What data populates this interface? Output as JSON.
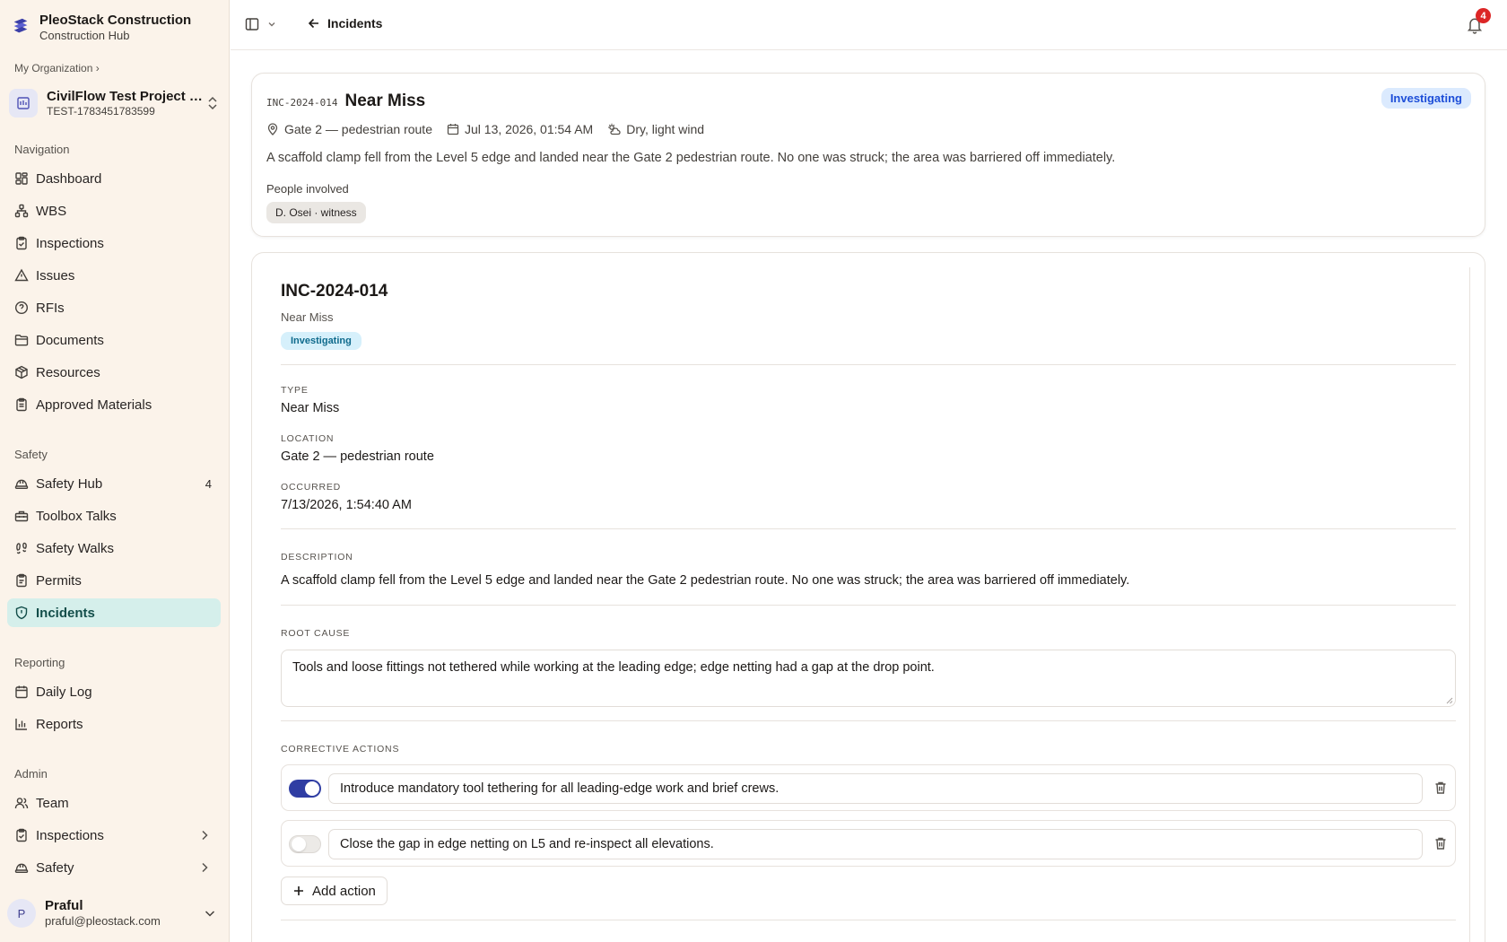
{
  "brand": {
    "title": "PleoStack Construction",
    "subtitle": "Construction Hub"
  },
  "org": {
    "crumb": "My Organization ›"
  },
  "project": {
    "name": "CivilFlow Test Project (U...",
    "code": "TEST-1783451783599"
  },
  "nav": {
    "navigation_label": "Navigation",
    "navigation": [
      {
        "label": "Dashboard",
        "icon": "dashboard-icon"
      },
      {
        "label": "WBS",
        "icon": "wbs-icon"
      },
      {
        "label": "Inspections",
        "icon": "clipboard-check-icon"
      },
      {
        "label": "Issues",
        "icon": "warning-triangle-icon"
      },
      {
        "label": "RFIs",
        "icon": "help-circle-icon"
      },
      {
        "label": "Documents",
        "icon": "folder-icon"
      },
      {
        "label": "Resources",
        "icon": "package-icon"
      },
      {
        "label": "Approved Materials",
        "icon": "clipboard-list-icon"
      }
    ],
    "safety_label": "Safety",
    "safety": [
      {
        "label": "Safety Hub",
        "icon": "hard-hat-icon",
        "badge": "4"
      },
      {
        "label": "Toolbox Talks",
        "icon": "toolbox-icon"
      },
      {
        "label": "Safety Walks",
        "icon": "footprints-icon"
      },
      {
        "label": "Permits",
        "icon": "clipboard-icon"
      },
      {
        "label": "Incidents",
        "icon": "shield-alert-icon",
        "active": true
      }
    ],
    "reporting_label": "Reporting",
    "reporting": [
      {
        "label": "Daily Log",
        "icon": "calendar-icon"
      },
      {
        "label": "Reports",
        "icon": "bar-chart-icon"
      }
    ],
    "admin_label": "Admin",
    "admin": [
      {
        "label": "Team",
        "icon": "users-icon"
      },
      {
        "label": "Inspections",
        "icon": "clipboard-check-icon"
      },
      {
        "label": "Safety",
        "icon": "hard-hat-icon"
      }
    ]
  },
  "user": {
    "initial": "P",
    "name": "Praful",
    "email": "praful@pleostack.com"
  },
  "topbar": {
    "back_label": "Incidents",
    "notification_count": "4"
  },
  "summary": {
    "id": "INC-2024-014",
    "title": "Near Miss",
    "status": "Investigating",
    "location": "Gate 2 — pedestrian route",
    "datetime": "Jul 13, 2026, 01:54 AM",
    "weather": "Dry, light wind",
    "description": "A scaffold clamp fell from the Level 5 edge and landed near the Gate 2 pedestrian route. No one was struck; the area was barriered off immediately.",
    "people_label": "People involved",
    "people": [
      "D. Osei · witness"
    ]
  },
  "detail": {
    "id": "INC-2024-014",
    "type_sub": "Near Miss",
    "status": "Investigating",
    "type_label": "Type",
    "type_value": "Near Miss",
    "location_label": "Location",
    "location_value": "Gate 2 — pedestrian route",
    "occurred_label": "Occurred",
    "occurred_value": "7/13/2026, 1:54:40 AM",
    "description_label": "Description",
    "description_value": "A scaffold clamp fell from the Level 5 edge and landed near the Gate 2 pedestrian route. No one was struck; the area was barriered off immediately.",
    "root_cause_label": "Root cause",
    "root_cause_value": "Tools and loose fittings not tethered while working at the leading edge; edge netting had a gap at the drop point.",
    "corrective_label": "Corrective actions",
    "actions": [
      {
        "text": "Introduce mandatory tool tethering for all leading-edge work and brief crews.",
        "done": true
      },
      {
        "text": "Close the gap in edge netting on L5 and re-inspect all elevations.",
        "done": false
      }
    ],
    "add_action_label": "Add action"
  },
  "colors": {
    "accent": "#2f3da3",
    "active_nav_bg": "#d5efeb",
    "status_bg": "#dbeafe",
    "status_text": "#1d4ed8",
    "sidebar_bg": "#fbf3ea"
  }
}
